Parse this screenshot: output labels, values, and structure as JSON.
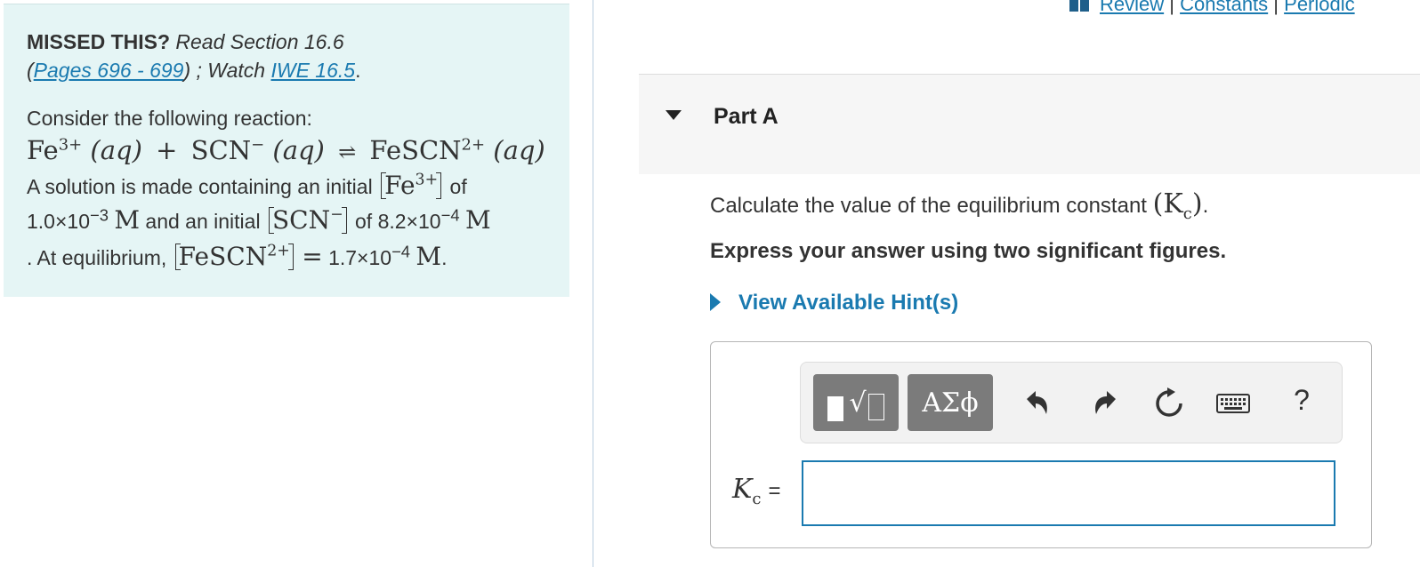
{
  "top_links": {
    "review": "Review",
    "sep1": "|",
    "constants": "Constants",
    "sep2": "|",
    "periodic": "Periodic"
  },
  "left_panel": {
    "missed_label": "MISSED THIS?",
    "read_text": "Read Section 16.6",
    "paren_open": "(",
    "pages_link": "Pages 696 - 699",
    "paren_close": ") ; Watch",
    "iwe_link": "IWE 16.5",
    "period": ".",
    "consider": "Consider the following reaction:",
    "line1_pre": "A solution is made containing an initial",
    "line1_post": "of",
    "conc_fe": "1.0×10",
    "conc_fe_exp": "−3",
    "unit_m": "M",
    "line2_mid": "and an initial",
    "line2_post": "of 8.2×10",
    "conc_scn_exp": "−4",
    "line3_pre": ". At equilibrium,",
    "equals": "=",
    "conc_eq": "1.7×10",
    "conc_eq_exp": "−4",
    "final_period": "."
  },
  "reaction": {
    "fe": "Fe",
    "fe_charge": "3+",
    "aq": "(aq)",
    "plus": "+",
    "scn": "SCN",
    "scn_charge": "−",
    "arrow": "⇌",
    "fescn": "FeSCN",
    "fescn_charge": "2+"
  },
  "part": {
    "title": "Part A"
  },
  "prompt": {
    "text": "Calculate the value of the equilibrium constant",
    "kc": "(K",
    "kc_sub": "c",
    "kc_close": ")",
    "period": "."
  },
  "instruction": "Express your answer using two significant figures.",
  "hints": "View Available Hint(s)",
  "toolbar": {
    "greek_label": "ΑΣϕ",
    "sqrt_label": "√",
    "help_label": "?"
  },
  "answer": {
    "label_k": "K",
    "label_sub": "c",
    "label_eq": "=",
    "value": ""
  },
  "icons": [
    "book-icon",
    "undo-icon",
    "redo-icon",
    "reset-icon",
    "keyboard-icon",
    "help-icon",
    "caret-down-icon",
    "caret-right-icon"
  ]
}
